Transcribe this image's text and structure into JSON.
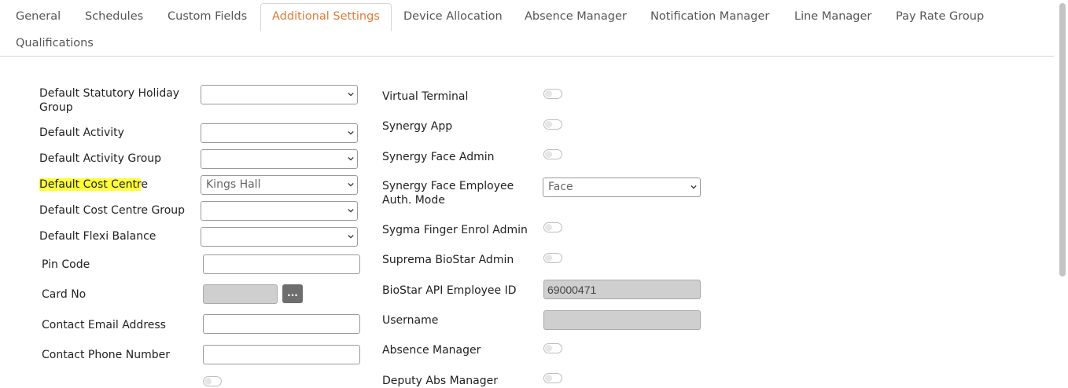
{
  "tabs": [
    {
      "label": "General"
    },
    {
      "label": "Schedules"
    },
    {
      "label": "Custom Fields"
    },
    {
      "label": "Additional Settings"
    },
    {
      "label": "Device Allocation"
    },
    {
      "label": "Absence Manager"
    },
    {
      "label": "Notification Manager"
    },
    {
      "label": "Line Manager"
    },
    {
      "label": "Pay Rate Group"
    },
    {
      "label": "Qualifications"
    }
  ],
  "active_tab": "Additional Settings",
  "left": {
    "statutory_holiday_group": {
      "label_line1": "Default Statutory Holiday",
      "label_line2": "Group",
      "value": ""
    },
    "activity": {
      "label": "Default Activity",
      "value": ""
    },
    "activity_group": {
      "label": "Default Activity Group",
      "value": ""
    },
    "cost_centre": {
      "label_highlighted": "Default Cost Centr",
      "label_rest": "e",
      "value": "Kings Hall"
    },
    "cost_centre_group": {
      "label": "Default Cost Centre Group",
      "value": ""
    },
    "flexi_balance": {
      "label": "Default Flexi Balance",
      "value": ""
    },
    "pin_code": {
      "label": "Pin Code",
      "value": ""
    },
    "card_no": {
      "label": "Card No",
      "value": "",
      "button": "..."
    },
    "contact_email": {
      "label": "Contact Email Address",
      "value": ""
    },
    "contact_phone": {
      "label": "Contact Phone Number",
      "value": ""
    }
  },
  "right": {
    "virtual_terminal": {
      "label": "Virtual Terminal",
      "on": false
    },
    "synergy_app": {
      "label": "Synergy App",
      "on": false
    },
    "synergy_face_admin": {
      "label": "Synergy Face Admin",
      "on": false
    },
    "face_auth_mode": {
      "label_line1": "Synergy Face Employee",
      "label_line2": "Auth. Mode",
      "value": "Face"
    },
    "sygma_finger_enrol_admin": {
      "label": "Sygma Finger Enrol Admin",
      "on": false
    },
    "suprema_biostar_admin": {
      "label": "Suprema BioStar Admin",
      "on": false
    },
    "biostar_api_employee_id": {
      "label": "BioStar API Employee ID",
      "value": "69000471"
    },
    "username": {
      "label": "Username",
      "value": ""
    },
    "absence_manager": {
      "label": "Absence Manager",
      "on": false
    },
    "deputy_abs_manager": {
      "label": "Deputy Abs Manager",
      "on": false
    }
  },
  "colors": {
    "accent": "#e07b39",
    "highlight": "#ffff3a"
  }
}
